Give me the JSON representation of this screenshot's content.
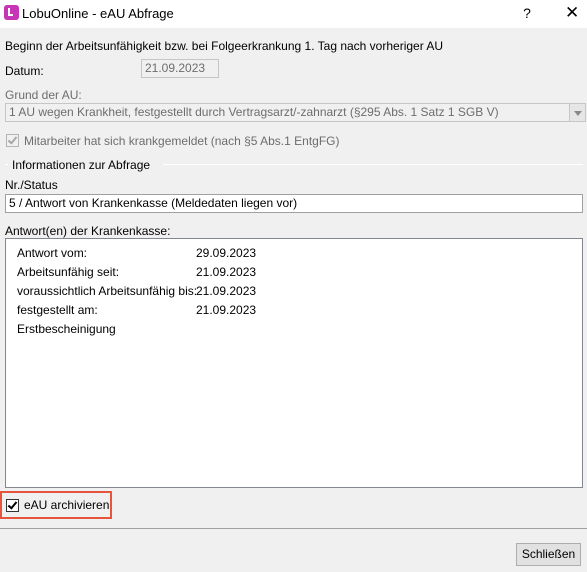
{
  "window": {
    "title": "LobuOnline - eAU Abfrage",
    "help_label": "?",
    "close_label": "✕"
  },
  "intro_text": "Beginn der Arbeitsunfähigkeit bzw. bei Folgeerkrankung 1. Tag nach vorheriger AU",
  "datum": {
    "label": "Datum:",
    "value": "21.09.2023"
  },
  "grund": {
    "label": "Grund der AU:",
    "value": "1 AU wegen Krankheit, festgestellt durch Vertragsarzt/-zahnarzt (§295 Abs. 1 Satz 1 SGB V)"
  },
  "krankgemeldet": {
    "label": "Mitarbeiter hat sich krankgemeldet (nach §5 Abs.1 EntgFG)",
    "checked": true
  },
  "info_group": {
    "title": "Informationen zur Abfrage",
    "status_label": "Nr./Status",
    "status_value": "5 / Antwort von Krankenkasse (Meldedaten liegen vor)"
  },
  "antworten": {
    "label": "Antwort(en) der Krankenkasse:",
    "rows": [
      {
        "key": "Antwort vom:",
        "value": "29.09.2023"
      },
      {
        "key": "Arbeitsunfähig seit:",
        "value": "21.09.2023"
      },
      {
        "key": "voraussichtlich Arbeitsunfähig bis:",
        "value": "21.09.2023"
      },
      {
        "key": "festgestellt am:",
        "value": "21.09.2023"
      }
    ],
    "extra": "Erstbescheinigung"
  },
  "archivieren": {
    "label": "eAU archivieren",
    "checked": true
  },
  "footer": {
    "close_button": "Schließen"
  },
  "colors": {
    "app_icon": "#c535b5",
    "highlight": "#e8553f"
  }
}
